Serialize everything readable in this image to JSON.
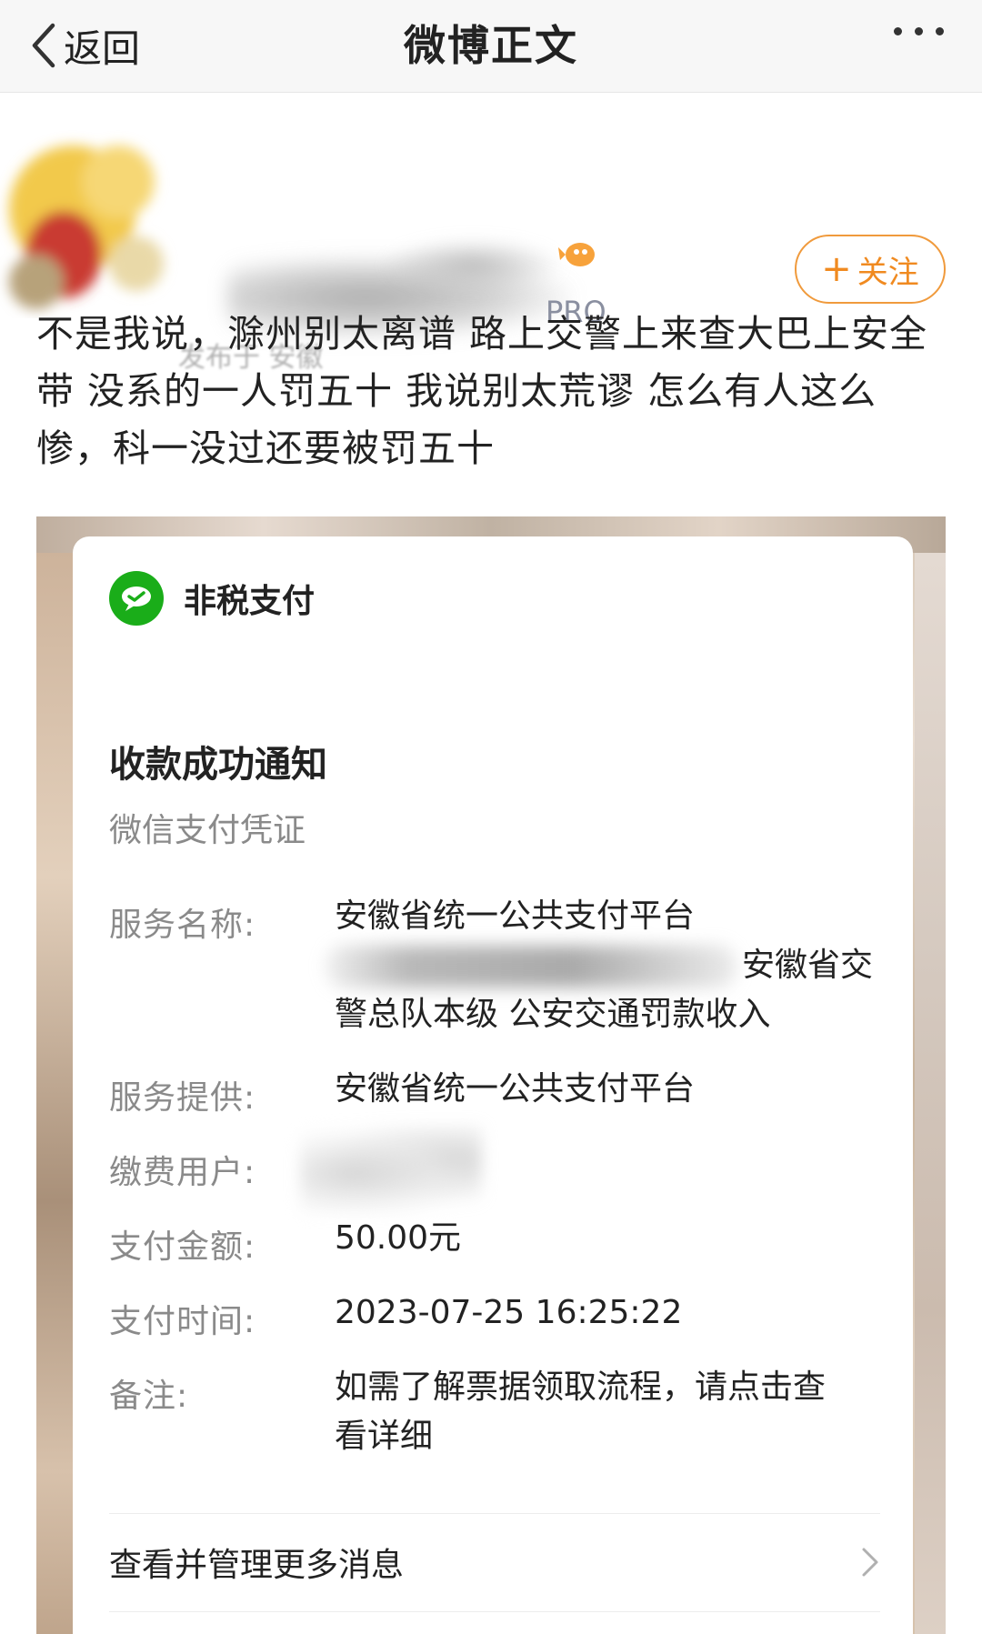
{
  "nav": {
    "back_label": "返回",
    "title": "微博正文"
  },
  "author": {
    "badge": "PRO",
    "publish_info": "发布于 安徽",
    "follow_label": "关注",
    "follow_plus": "+"
  },
  "post": {
    "text": "不是我说，滁州别太离谱 路上交警上来查大巴上安全带 没系的一人罚五十 我说别太荒谬 怎么有人这么惨，科一没过还要被罚五十"
  },
  "receipt": {
    "app_name": "非税支付",
    "title": "收款成功通知",
    "subtitle": "微信支付凭证",
    "rows": [
      {
        "label": "服务名称:",
        "value_line1": "安徽省统一公共支付平台",
        "value_line2": "安徽省交",
        "value_line3": "警总队本级 公安交通罚款收入"
      },
      {
        "label": "服务提供:",
        "value": "安徽省统一公共支付平台"
      },
      {
        "label": "缴费用户:",
        "value": ""
      },
      {
        "label": "支付金额:",
        "value": "50.00元"
      },
      {
        "label": "支付时间:",
        "value": "2023-07-25 16:25:22"
      },
      {
        "label": "备注:",
        "value_line1": "如需了解票据领取流程，请点击查",
        "value_line2": "看详细"
      }
    ],
    "more_messages": "查看并管理更多消息"
  },
  "colors": {
    "accent_orange": "#f08a20",
    "wechat_green": "#1aad19",
    "label_gray": "#8a8a8a"
  },
  "icons": [
    "chevron-left-icon",
    "more-dots-icon",
    "wechat-pay-icon",
    "chevron-right-icon"
  ]
}
